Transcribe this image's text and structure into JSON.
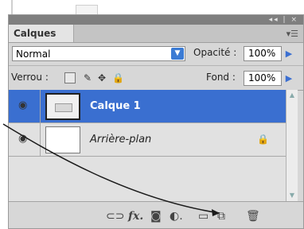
{
  "panel": {
    "title": "Calques",
    "window_controls": "◂◂ | ×"
  },
  "blend": {
    "mode": "Normal",
    "opacity_label": "Opacité :",
    "opacity_value": "100%"
  },
  "lock": {
    "label": "Verrou :",
    "fill_label": "Fond :",
    "fill_value": "100%"
  },
  "layers": [
    {
      "name": "Calque 1",
      "selected": true
    },
    {
      "name": "Arrière-plan",
      "locked": true
    }
  ],
  "footer_icons": [
    "link-layers-icon",
    "fx-icon",
    "mask-icon",
    "adjustment-icon",
    "group-folder-icon",
    "new-layer-icon",
    "trash-icon"
  ],
  "colors": {
    "accent": "#3a6fd0",
    "arrow": "#1a1a1a"
  }
}
